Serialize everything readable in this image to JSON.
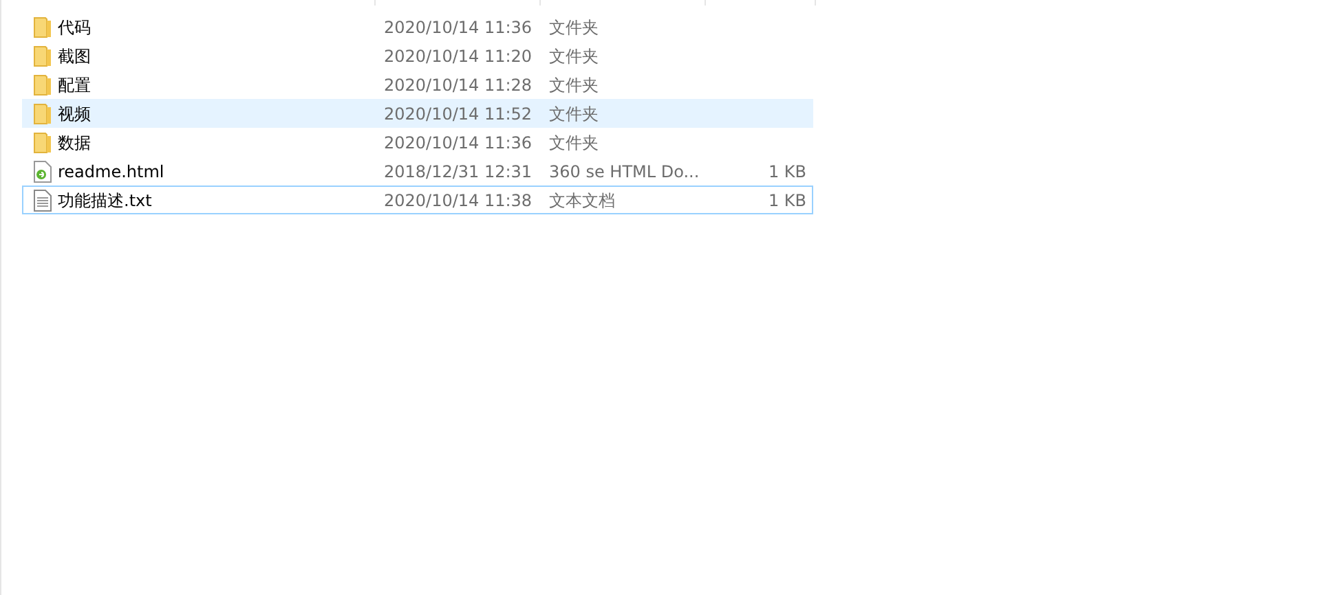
{
  "files": [
    {
      "kind": "folder",
      "name": "代码",
      "modified": "2020/10/14 11:36",
      "type": "文件夹",
      "hovered": false,
      "focused": false
    },
    {
      "kind": "folder",
      "name": "截图",
      "modified": "2020/10/14 11:20",
      "type": "文件夹",
      "hovered": false,
      "focused": false
    },
    {
      "kind": "folder",
      "name": "配置",
      "modified": "2020/10/14 11:28",
      "type": "文件夹",
      "hovered": false,
      "focused": false
    },
    {
      "kind": "folder",
      "name": "视频",
      "modified": "2020/10/14 11:52",
      "type": "文件夹",
      "hovered": true,
      "focused": false
    },
    {
      "kind": "folder",
      "name": "数据",
      "modified": "2020/10/14 11:36",
      "type": "文件夹",
      "hovered": false,
      "focused": false
    },
    {
      "kind": "html",
      "name": "readme.html",
      "modified": "2018/12/31 12:31",
      "type": "360 se HTML Do...",
      "size": "1 KB",
      "hovered": false,
      "focused": false
    },
    {
      "kind": "text",
      "name": "功能描述.txt",
      "modified": "2020/10/14 11:38",
      "type": "文本文档",
      "size": "1 KB",
      "hovered": false,
      "focused": true
    }
  ]
}
